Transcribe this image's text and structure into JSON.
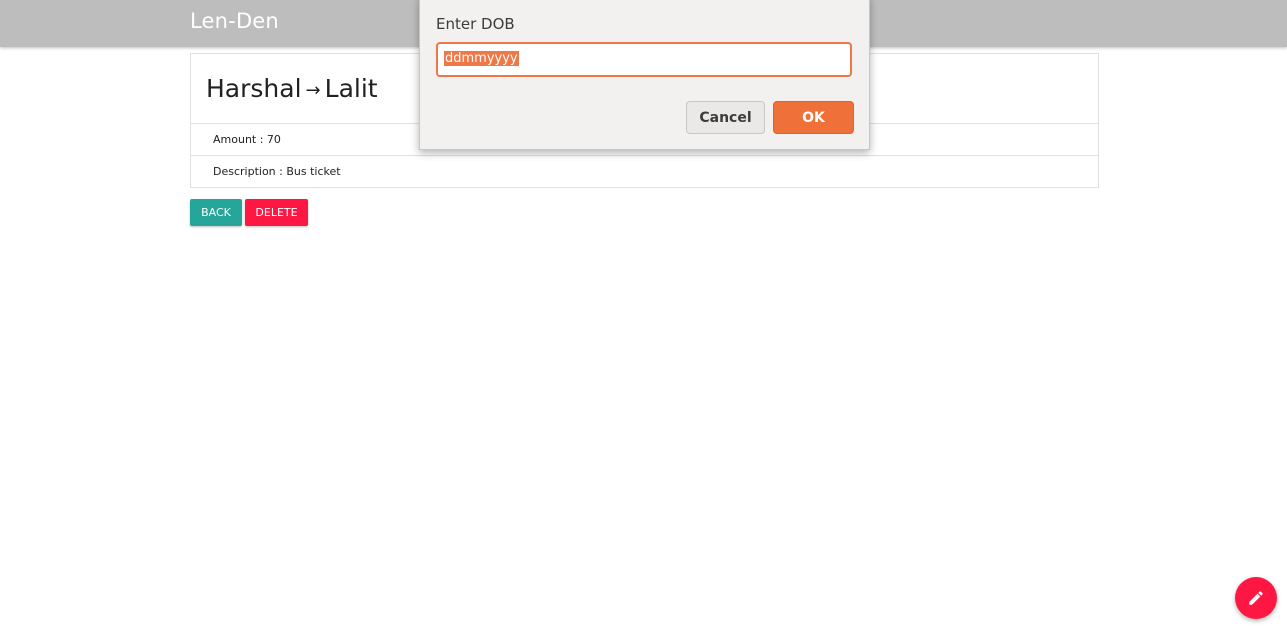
{
  "app": {
    "title": "Len-Den"
  },
  "transaction": {
    "from": "Harshal",
    "arrow": "→",
    "to": "Lalit",
    "amount_text": "Amount : 70",
    "description_text": "Description : Bus ticket"
  },
  "actions": {
    "back_label": "BACK",
    "delete_label": "DELETE"
  },
  "fab": {
    "icon": "pencil-icon"
  },
  "dialog": {
    "label": "Enter DOB",
    "input_value": "ddmmyyyy",
    "cancel_label": "Cancel",
    "ok_label": "OK"
  },
  "colors": {
    "topbar": "#bdbdbd",
    "back": "#26a69a",
    "delete": "#ff1744",
    "fab": "#ff1744",
    "dialog_accent": "#f07746"
  }
}
